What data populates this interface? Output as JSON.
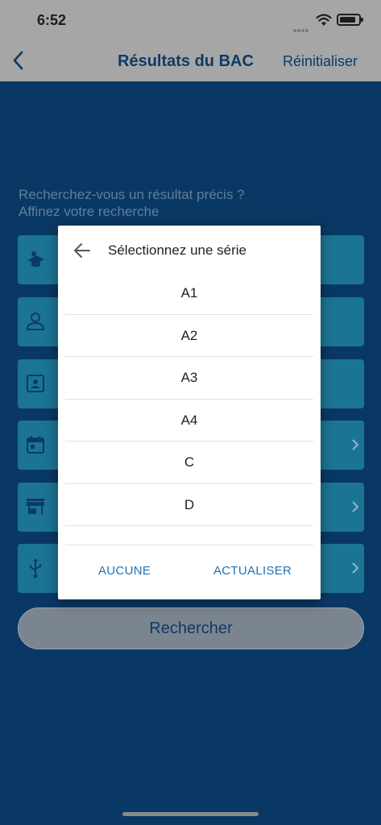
{
  "status_bar": {
    "time": "6:52"
  },
  "nav": {
    "title": "Résultats du BAC",
    "reset_label": "Réinitialiser"
  },
  "hint": {
    "line1": "Recherchez-vous un résultat précis ?",
    "line2": "Affinez votre recherche"
  },
  "fields": [
    {
      "icon": "graduation-cap-icon"
    },
    {
      "icon": "person-icon"
    },
    {
      "icon": "id-card-icon"
    },
    {
      "icon": "calendar-icon",
      "has_chevron": true
    },
    {
      "icon": "store-icon",
      "has_chevron": true
    },
    {
      "icon": "usb-icon",
      "has_chevron": true
    }
  ],
  "search_button": {
    "label": "Rechercher"
  },
  "dialog": {
    "title": "Sélectionnez une série",
    "options": [
      "A1",
      "A2",
      "A3",
      "A4",
      "C",
      "D"
    ],
    "none_label": "AUCUNE",
    "update_label": "ACTUALISER"
  },
  "colors": {
    "background": "#0a3864",
    "field": "#1b7494",
    "accent": "#1e73b8",
    "bar": "#a6a6a6"
  }
}
